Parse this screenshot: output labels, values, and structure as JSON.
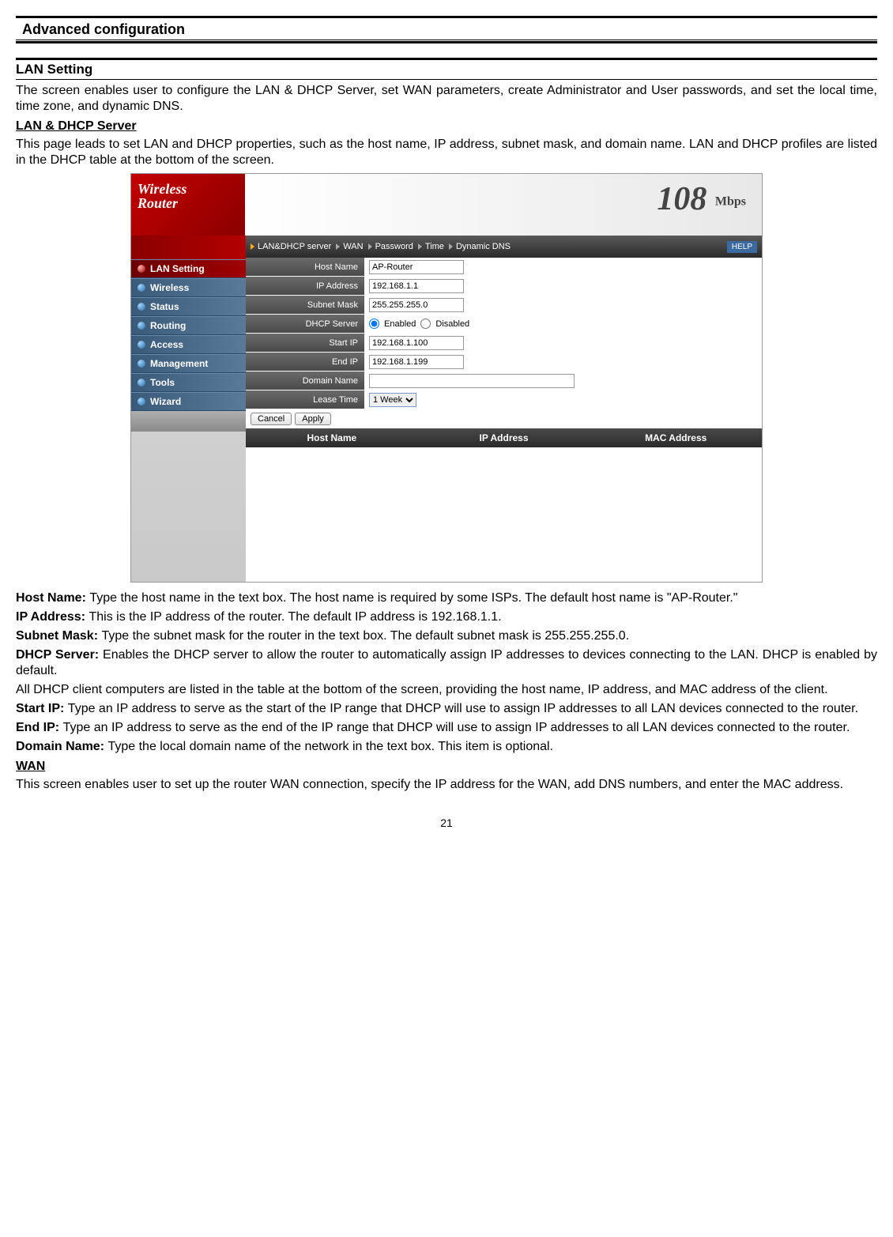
{
  "page": {
    "section_header": "Advanced configuration",
    "page_number": "21"
  },
  "headings": {
    "lan_setting": "LAN Setting",
    "lan_dhcp": "LAN & DHCP Server",
    "wan": "WAN"
  },
  "paragraphs": {
    "intro": "The screen enables user to configure the LAN & DHCP Server, set WAN parameters, create Administrator and User passwords, and set the local time, time zone, and dynamic DNS.",
    "lan_dhcp_desc": "This page leads to set LAN and DHCP properties, such as the host name, IP address, subnet mask, and domain name. LAN and DHCP profiles are listed in the DHCP table at the bottom of the screen.",
    "host_name_label": "Host Name: ",
    "host_name_text": "Type the host name in the text box. The host name is required by some ISPs. The default host name is \"AP-Router.\"",
    "ip_label": "IP Address: ",
    "ip_text": "This is the IP address of the router. The default IP address is 192.168.1.1.",
    "subnet_label": "Subnet Mask: ",
    "subnet_text": "Type the subnet mask for the router in the text box. The default subnet mask is 255.255.255.0.",
    "dhcp_label": "DHCP Server: ",
    "dhcp_text": "Enables the DHCP server to allow the router to automatically assign IP addresses to devices connecting to the LAN. DHCP is enabled by default.",
    "dhcp_note": "All DHCP client computers are listed in the table at the bottom of the screen, providing the host name, IP address, and MAC address of the client.",
    "start_label": "Start IP: ",
    "start_text": "Type an IP address to serve as the start of the IP range that DHCP will use to assign IP addresses to all LAN devices connected to the router.",
    "end_label": "End IP: ",
    "end_text": "Type an IP address to serve as the end of the IP range that DHCP will use to assign IP addresses to all LAN devices connected to the router.",
    "domain_label": "Domain Name: ",
    "domain_text": "Type the local domain name of the network in the text box. This item is optional.",
    "wan_text": "This screen enables user to set up the router WAN connection, specify the IP address for the WAN, add DNS numbers, and enter the MAC address."
  },
  "router": {
    "banner": {
      "brand_l1": "Wireless",
      "brand_l2": "Router",
      "speed": "108",
      "mbps": "Mbps"
    },
    "sidebar": [
      {
        "label": "LAN Setting",
        "active": true
      },
      {
        "label": "Wireless",
        "active": false
      },
      {
        "label": "Status",
        "active": false
      },
      {
        "label": "Routing",
        "active": false
      },
      {
        "label": "Access",
        "active": false
      },
      {
        "label": "Management",
        "active": false
      },
      {
        "label": "Tools",
        "active": false
      },
      {
        "label": "Wizard",
        "active": false
      }
    ],
    "tabs": {
      "t0": "LAN&DHCP server",
      "t1": "WAN",
      "t2": "Password",
      "t3": "Time",
      "t4": "Dynamic DNS",
      "help": "HELP"
    },
    "form": {
      "host_name_label": "Host Name",
      "host_name_value": "AP-Router",
      "ip_label": "IP Address",
      "ip_value": "192.168.1.1",
      "subnet_label": "Subnet Mask",
      "subnet_value": "255.255.255.0",
      "dhcp_label": "DHCP Server",
      "dhcp_enabled": "Enabled",
      "dhcp_disabled": "Disabled",
      "start_label": "Start IP",
      "start_value": "192.168.1.100",
      "end_label": "End IP",
      "end_value": "192.168.1.199",
      "domain_label": "Domain Name",
      "domain_value": "",
      "lease_label": "Lease Time",
      "lease_value": "1 Week",
      "cancel": "Cancel",
      "apply": "Apply"
    },
    "table": {
      "h1": "Host Name",
      "h2": "IP Address",
      "h3": "MAC Address"
    }
  }
}
